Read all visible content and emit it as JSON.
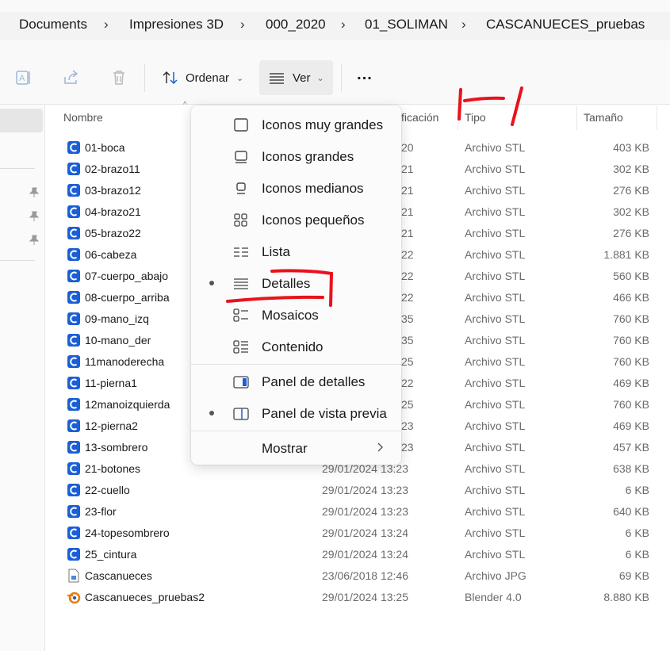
{
  "breadcrumb": [
    "Documents",
    "Impresiones 3D",
    "000_2020",
    "01_SOLIMAN",
    "CASCANUECES_pruebas"
  ],
  "toolbar": {
    "sort_label": "Ordenar",
    "view_label": "Ver",
    "more_label": "..."
  },
  "columns": {
    "name": "Nombre",
    "modified": "ficación",
    "type": "Tipo",
    "size": "Tamaño"
  },
  "files": [
    {
      "name": "01-boca",
      "date": "20",
      "type": "Archivo STL",
      "size": "403 KB",
      "icon": "stl-icon"
    },
    {
      "name": "02-brazo11",
      "date": "21",
      "type": "Archivo STL",
      "size": "302 KB",
      "icon": "stl-icon"
    },
    {
      "name": "03-brazo12",
      "date": "21",
      "type": "Archivo STL",
      "size": "276 KB",
      "icon": "stl-icon"
    },
    {
      "name": "04-brazo21",
      "date": "21",
      "type": "Archivo STL",
      "size": "302 KB",
      "icon": "stl-icon"
    },
    {
      "name": "05-brazo22",
      "date": "21",
      "type": "Archivo STL",
      "size": "276 KB",
      "icon": "stl-icon"
    },
    {
      "name": "06-cabeza",
      "date": "22",
      "type": "Archivo STL",
      "size": "1.881 KB",
      "icon": "stl-icon"
    },
    {
      "name": "07-cuerpo_abajo",
      "date": "22",
      "type": "Archivo STL",
      "size": "560 KB",
      "icon": "stl-icon"
    },
    {
      "name": "08-cuerpo_arriba",
      "date": "22",
      "type": "Archivo STL",
      "size": "466 KB",
      "icon": "stl-icon"
    },
    {
      "name": "09-mano_izq",
      "date": "35",
      "type": "Archivo STL",
      "size": "760 KB",
      "icon": "stl-icon"
    },
    {
      "name": "10-mano_der",
      "date": "35",
      "type": "Archivo STL",
      "size": "760 KB",
      "icon": "stl-icon"
    },
    {
      "name": "11manoderecha",
      "date": "25",
      "type": "Archivo STL",
      "size": "760 KB",
      "icon": "stl-icon"
    },
    {
      "name": "11-pierna1",
      "date": "22",
      "type": "Archivo STL",
      "size": "469 KB",
      "icon": "stl-icon"
    },
    {
      "name": "12manoizquierda",
      "date": "25",
      "type": "Archivo STL",
      "size": "760 KB",
      "icon": "stl-icon"
    },
    {
      "name": "12-pierna2",
      "date": "23",
      "type": "Archivo STL",
      "size": "469 KB",
      "icon": "stl-icon"
    },
    {
      "name": "13-sombrero",
      "date": "23",
      "type": "Archivo STL",
      "size": "457 KB",
      "icon": "stl-icon"
    },
    {
      "name": "21-botones",
      "date": "29/01/2024 13:23",
      "type": "Archivo STL",
      "size": "638 KB",
      "icon": "stl-icon"
    },
    {
      "name": "22-cuello",
      "date": "29/01/2024 13:23",
      "type": "Archivo STL",
      "size": "6 KB",
      "icon": "stl-icon"
    },
    {
      "name": "23-flor",
      "date": "29/01/2024 13:23",
      "type": "Archivo STL",
      "size": "640 KB",
      "icon": "stl-icon"
    },
    {
      "name": "24-topesombrero",
      "date": "29/01/2024 13:24",
      "type": "Archivo STL",
      "size": "6 KB",
      "icon": "stl-icon"
    },
    {
      "name": "25_cintura",
      "date": "29/01/2024 13:24",
      "type": "Archivo STL",
      "size": "6 KB",
      "icon": "stl-icon"
    },
    {
      "name": "Cascanueces",
      "date": "23/06/2018 12:46",
      "type": "Archivo JPG",
      "size": "69 KB",
      "icon": "jpg-icon"
    },
    {
      "name": "Cascanueces_pruebas2",
      "date": "29/01/2024 13:25",
      "type": "Blender 4.0",
      "size": "8.880 KB",
      "icon": "blender-icon"
    }
  ],
  "view_menu": {
    "items": [
      {
        "label": "Iconos muy grandes",
        "icon": "extra-large-icons-icon",
        "selected": false
      },
      {
        "label": "Iconos grandes",
        "icon": "large-icons-icon",
        "selected": false
      },
      {
        "label": "Iconos medianos",
        "icon": "medium-icons-icon",
        "selected": false
      },
      {
        "label": "Iconos pequeños",
        "icon": "small-icons-icon",
        "selected": false
      },
      {
        "label": "Lista",
        "icon": "list-icon",
        "selected": false
      },
      {
        "label": "Detalles",
        "icon": "details-icon",
        "selected": true
      },
      {
        "label": "Mosaicos",
        "icon": "tiles-icon",
        "selected": false
      },
      {
        "label": "Contenido",
        "icon": "content-icon",
        "selected": false
      }
    ],
    "panes": [
      {
        "label": "Panel de detalles",
        "icon": "details-pane-icon",
        "selected": false
      },
      {
        "label": "Panel de vista previa",
        "icon": "preview-pane-icon",
        "selected": true
      }
    ],
    "show_label": "Mostrar"
  },
  "colors": {
    "stl_icon": "#1a5fd6",
    "annotation": "#e8131c",
    "menu_bg": "#fbfbfb"
  }
}
